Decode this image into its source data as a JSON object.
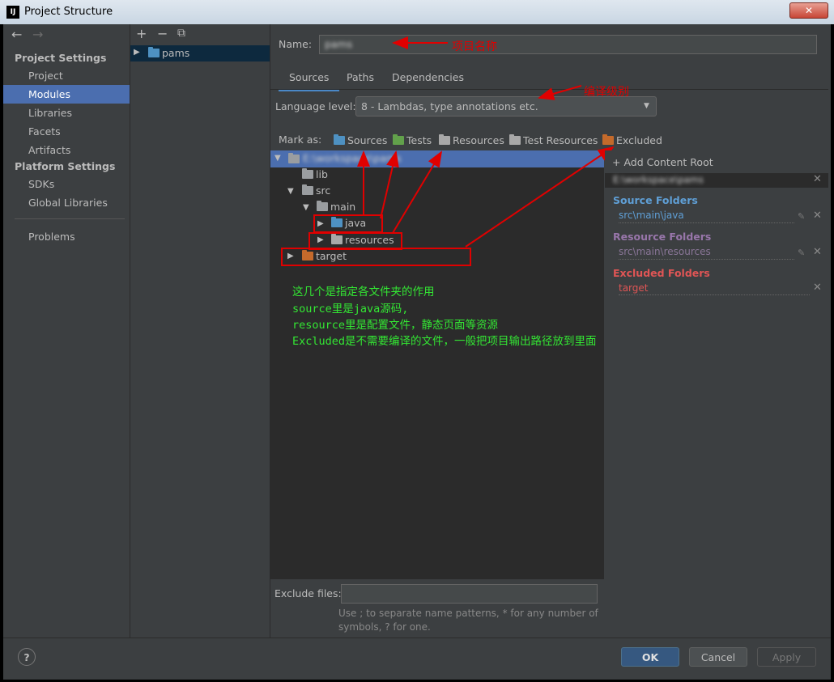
{
  "window": {
    "title": "Project Structure",
    "app_icon": "IJ"
  },
  "nav": {
    "project_settings_header": "Project Settings",
    "project": "Project",
    "modules": "Modules",
    "libraries": "Libraries",
    "facets": "Facets",
    "artifacts": "Artifacts",
    "platform_settings_header": "Platform Settings",
    "sdks": "SDKs",
    "global_libraries": "Global Libraries",
    "problems": "Problems"
  },
  "modules": {
    "add": "+",
    "remove": "−",
    "copy": "⧉",
    "items": [
      "pams"
    ]
  },
  "main": {
    "name_label": "Name:",
    "name_value": "pams",
    "tabs": [
      "Sources",
      "Paths",
      "Dependencies"
    ],
    "language_level_label": "Language level:",
    "language_level_value": "8 - Lambdas, type annotations etc.",
    "mark_as_label": "Mark as:",
    "mark_as": [
      "Sources",
      "Tests",
      "Resources",
      "Test Resources",
      "Excluded"
    ],
    "tree": {
      "root": "E:\\workspace\\pams",
      "lib": "lib",
      "src": "src",
      "main": "main",
      "java": "java",
      "resources": "resources",
      "target": "target"
    },
    "exclude_files_label": "Exclude files:",
    "exclude_hint_1": "Use ; to separate name patterns, * for any number of",
    "exclude_hint_2": "symbols, ? for one."
  },
  "content_root": {
    "add_label": "+ Add Content Root",
    "path": "E:\\workspace\\pams",
    "source_header": "Source Folders",
    "source_path": "src\\main\\java",
    "resource_header": "Resource Folders",
    "resource_path": "src\\main\\resources",
    "excluded_header": "Excluded Folders",
    "excluded_path": "target"
  },
  "annotations": {
    "project_name": "项目名称",
    "compile_level": "编译级别",
    "line1": "这几个是指定各文件夹的作用",
    "line2": "source里是java源码,",
    "line3": "resource里是配置文件，静态页面等资源",
    "line4": "Excluded是不需要编译的文件，一般把项目输出路径放到里面"
  },
  "buttons": {
    "help": "?",
    "ok": "OK",
    "cancel": "Cancel",
    "apply": "Apply"
  },
  "colors": {
    "accent": "#4b6eaf",
    "source": "#4e91c2",
    "resource": "#9876aa",
    "excluded": "#e05555",
    "annotation_red": "#e00000",
    "annotation_green": "#33e633"
  }
}
